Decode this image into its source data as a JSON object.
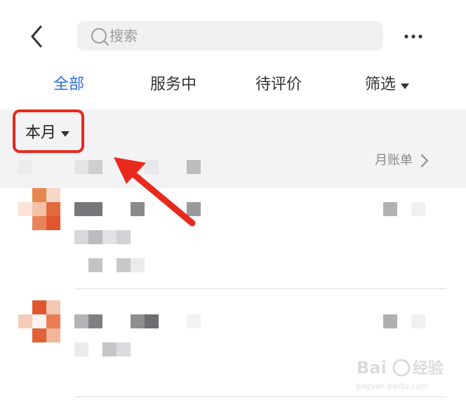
{
  "header": {
    "search_placeholder": "搜索",
    "more_label": "···"
  },
  "tabs": [
    {
      "label": "全部",
      "active": true
    },
    {
      "label": "服务中",
      "active": false
    },
    {
      "label": "待评价",
      "active": false
    },
    {
      "label": "筛选",
      "active": false
    }
  ],
  "filter": {
    "period_label": "本月",
    "bill_link": "月账单"
  },
  "colors": {
    "accent": "#2f6fe0",
    "highlight": "#e82a1c",
    "avatar_orange": "#e0562f"
  },
  "icons": [
    "back-arrow-icon",
    "search-icon",
    "more-icon",
    "caret-down-icon",
    "chevron-right-icon"
  ],
  "watermark": {
    "brand": "Baidu",
    "sub": "经验",
    "url": "jingyan.baidu.com"
  }
}
